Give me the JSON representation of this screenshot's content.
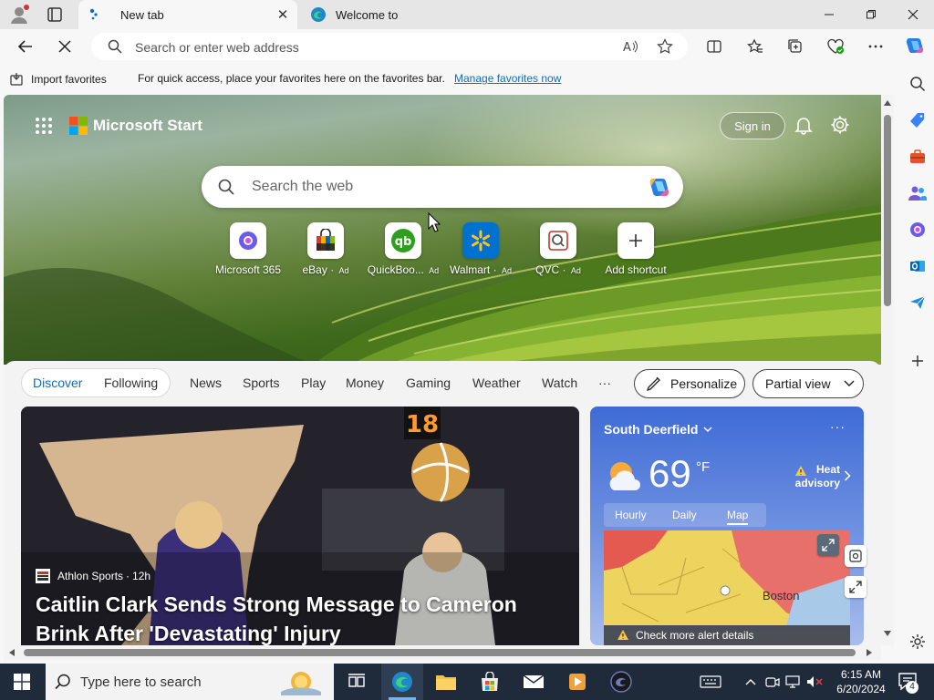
{
  "browser": {
    "tabs": [
      {
        "title": "New tab",
        "favicon": "edge-newtab-icon",
        "active": true
      },
      {
        "title": "Welcome to",
        "favicon": "edge-logo-icon",
        "active": false
      }
    ],
    "address_placeholder": "Search or enter web address",
    "window_controls": [
      "minimize-icon",
      "restore-icon",
      "close-icon"
    ]
  },
  "favorites_bar": {
    "import_label": "Import favorites",
    "message": "For quick access, place your favorites here on the favorites bar.",
    "link": "Manage favorites now"
  },
  "start_page": {
    "brand": "Microsoft Start",
    "sign_in": "Sign in",
    "search_placeholder": "Search the web",
    "shortcuts": [
      {
        "label": "Microsoft 365",
        "ad": "",
        "icon": "m365-icon"
      },
      {
        "label": "eBay",
        "ad": "Ad",
        "icon": "ebay-bag-icon"
      },
      {
        "label": "QuickBoo...",
        "ad": "Ad",
        "icon": "quickbooks-icon"
      },
      {
        "label": "Walmart",
        "ad": "Ad",
        "icon": "walmart-spark-icon"
      },
      {
        "label": "QVC",
        "ad": "Ad",
        "icon": "qvc-icon"
      },
      {
        "label": "Add shortcut",
        "ad": "",
        "icon": "plus-icon"
      }
    ],
    "feed_tabs": {
      "discover": "Discover",
      "following": "Following"
    },
    "nav": [
      "News",
      "Sports",
      "Play",
      "Money",
      "Gaming",
      "Weather",
      "Watch",
      "···"
    ],
    "personalize": "Personalize",
    "view_mode": "Partial view",
    "colors": {
      "accent": "#0f6cbd",
      "weather_top": "#3e6bd6"
    }
  },
  "news_card": {
    "source": "Athlon Sports",
    "age": "12h",
    "headline": "Caitlin Clark Sends Strong Message to Cameron Brink After 'Devastating' Injury"
  },
  "weather": {
    "location": "South Deerfield",
    "temperature": "69",
    "unit": "°F",
    "alert": "Heat advisory",
    "tabs": [
      "Hourly",
      "Daily",
      "Map"
    ],
    "active_tab": "Map",
    "map_label": "Boston",
    "alert_bar": "Check more alert details"
  },
  "taskbar": {
    "search_placeholder": "Type here to search",
    "time": "6:15 AM",
    "date": "6/20/2024",
    "notification_count": "4"
  }
}
